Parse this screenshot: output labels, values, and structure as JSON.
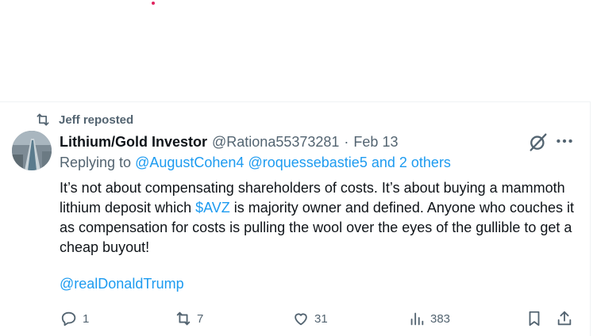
{
  "repost": {
    "label": "Jeff reposted"
  },
  "tweet": {
    "author": "Lithium/Gold Investor",
    "handle": "@Rationa55373281",
    "separator": "·",
    "date": "Feb 13",
    "reply": {
      "prefix": "Replying to",
      "mention1": "@AugustCohen4",
      "mention2": "@roquessebastie5",
      "and_others": "and 2 others"
    },
    "text": {
      "part1": "It’s not about compensating shareholders of costs. It’s about buying a mammoth lithium deposit which ",
      "cashtag": "$AVZ",
      "part2": " is majority owner and defined. Anyone who couches it as compensation for costs is pulling the wool over the eyes of the gullible to get a cheap buyout!"
    },
    "mention_line": "@realDonaldTrump"
  },
  "actions": {
    "replies": "1",
    "reposts": "7",
    "likes": "31",
    "views": "383"
  },
  "icons": [
    "repost-icon",
    "grok-icon",
    "more-icon",
    "reply-icon",
    "like-icon",
    "views-icon",
    "bookmark-icon",
    "share-icon"
  ],
  "colors": {
    "link": "#1d9bf0",
    "secondary": "#536471",
    "text": "#0f1419"
  }
}
